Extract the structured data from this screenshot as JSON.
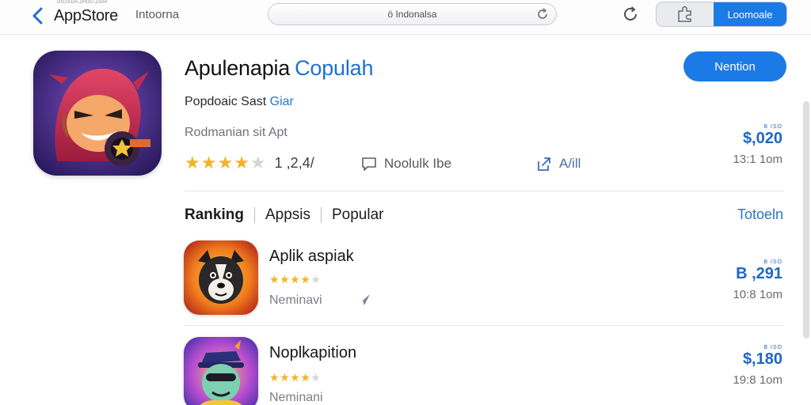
{
  "topbar": {
    "tiny_text": "DICIADA ZHOU ZAAF",
    "back_label": "AppStore",
    "crumb": "Intoorna",
    "address": "ö Indonalsa",
    "primary_button": "Loomoale"
  },
  "featured": {
    "title": "Apulenapia",
    "title_accent": "Copulah",
    "get_label": "Nention",
    "subtitle": "Popdoaic Sast",
    "subtitle_accent": "Giar",
    "developer": "Rodmanian sit Apt",
    "rating": 4.2,
    "rating_count": "1 ,2,4/",
    "message_label": "Noolulk Ibe",
    "add_label": "A/ill",
    "price_top": "B ISO",
    "price": "$,020",
    "size": "13:1 1om"
  },
  "tabs": [
    {
      "label": "Ranking",
      "active": true
    },
    {
      "label": "Appsis",
      "active": false
    },
    {
      "label": "Popular",
      "active": false
    }
  ],
  "see_all": "Totoeln",
  "rows": [
    {
      "title": "Aplik aspiak",
      "rating": 4.5,
      "sub": "Neminavi",
      "price_top": "B ISO",
      "price": "B ,291",
      "size": "10:8 1om"
    },
    {
      "title": "Noplkapition",
      "rating": 4.5,
      "sub": "Neminani",
      "price_top": "B ISO",
      "price": "$,180",
      "size": "19:8 1om"
    }
  ],
  "colors": {
    "accent": "#1c7ae6",
    "star": "#f5b225",
    "link": "#2a75cc"
  }
}
